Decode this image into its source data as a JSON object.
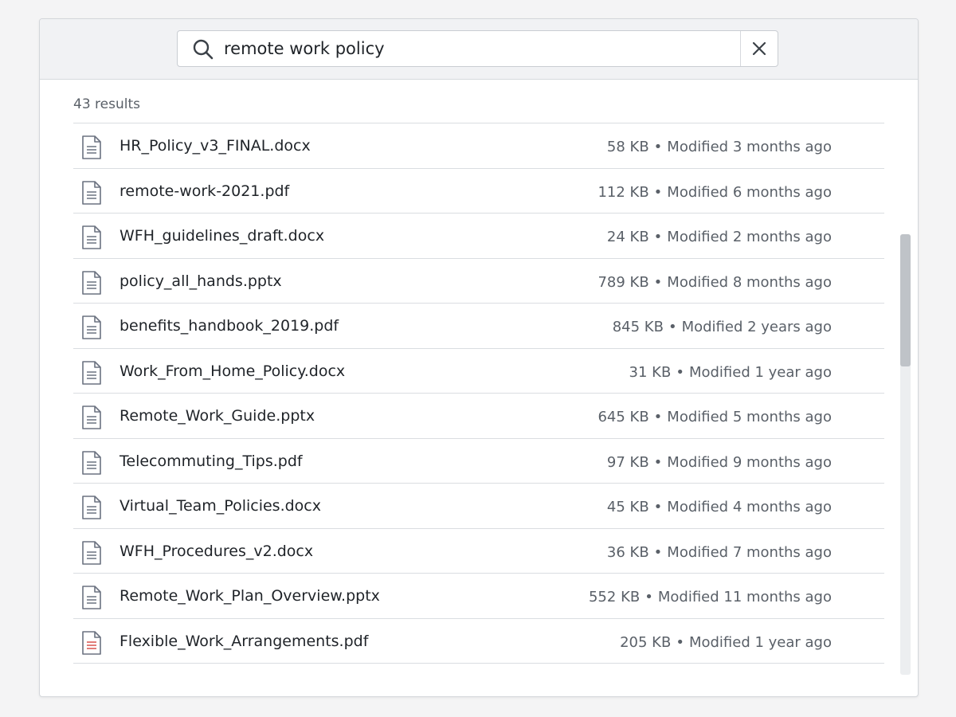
{
  "search": {
    "query": "remote work policy",
    "clear_label": "Clear search"
  },
  "results_count_label": "43 results",
  "meta_separator": "•",
  "results": [
    {
      "name": "HR_Policy_v3_FINAL.docx",
      "size": "58 KB",
      "modified": "Modified 3 months ago",
      "icon": "document-icon",
      "accent": "#6b7280"
    },
    {
      "name": "remote-work-2021.pdf",
      "size": "112 KB",
      "modified": "Modified 6 months ago",
      "icon": "document-icon",
      "accent": "#6b7280"
    },
    {
      "name": "WFH_guidelines_draft.docx",
      "size": "24 KB",
      "modified": "Modified 2 months ago",
      "icon": "document-icon",
      "accent": "#6b7280"
    },
    {
      "name": "policy_all_hands.pptx",
      "size": "789 KB",
      "modified": "Modified 8 months ago",
      "icon": "document-icon",
      "accent": "#6b7280"
    },
    {
      "name": "benefits_handbook_2019.pdf",
      "size": "845 KB",
      "modified": "Modified 2 years ago",
      "icon": "document-icon",
      "accent": "#6b7280"
    },
    {
      "name": "Work_From_Home_Policy.docx",
      "size": "31 KB",
      "modified": "Modified 1 year ago",
      "icon": "document-icon",
      "accent": "#6b7280"
    },
    {
      "name": "Remote_Work_Guide.pptx",
      "size": "645 KB",
      "modified": "Modified 5 months ago",
      "icon": "document-icon",
      "accent": "#6b7280"
    },
    {
      "name": "Telecommuting_Tips.pdf",
      "size": "97 KB",
      "modified": "Modified 9 months ago",
      "icon": "document-icon",
      "accent": "#6b7280"
    },
    {
      "name": "Virtual_Team_Policies.docx",
      "size": "45 KB",
      "modified": "Modified 4 months ago",
      "icon": "document-icon",
      "accent": "#6b7280"
    },
    {
      "name": "WFH_Procedures_v2.docx",
      "size": "36 KB",
      "modified": "Modified 7 months ago",
      "icon": "document-icon",
      "accent": "#6b7280"
    },
    {
      "name": "Remote_Work_Plan_Overview.pptx",
      "size": "552 KB",
      "modified": "Modified 11 months ago",
      "icon": "document-icon",
      "accent": "#6b7280"
    },
    {
      "name": "Flexible_Work_Arrangements.pdf",
      "size": "205 KB",
      "modified": "Modified 1 year ago",
      "icon": "pdf-document-icon",
      "accent": "#d9534f"
    }
  ],
  "scrollbar": {
    "position_fraction": 0.0,
    "visible_fraction": 0.3
  }
}
